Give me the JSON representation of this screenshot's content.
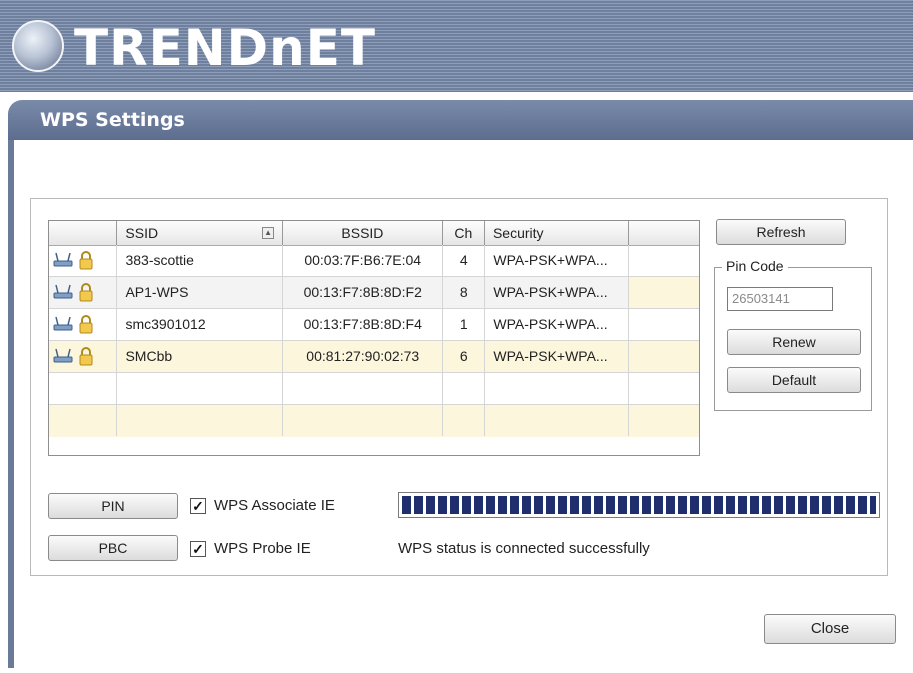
{
  "brand": {
    "name": "TRENDnET"
  },
  "window": {
    "title": "WPS Settings"
  },
  "table": {
    "headers": [
      "",
      "SSID",
      "BSSID",
      "Ch",
      "Security",
      ""
    ],
    "rows": [
      {
        "ssid": "383-scottie",
        "bssid": "00:03:7F:B6:7E:04",
        "ch": "4",
        "security": "WPA-PSK+WPA..."
      },
      {
        "ssid": "AP1-WPS",
        "bssid": "00:13:F7:8B:8D:F2",
        "ch": "8",
        "security": "WPA-PSK+WPA..."
      },
      {
        "ssid": "smc3901012",
        "bssid": "00:13:F7:8B:8D:F4",
        "ch": "1",
        "security": "WPA-PSK+WPA..."
      },
      {
        "ssid": "SMCbb",
        "bssid": "00:81:27:90:02:73",
        "ch": "6",
        "security": "WPA-PSK+WPA..."
      }
    ]
  },
  "buttons": {
    "refresh": "Refresh",
    "renew": "Renew",
    "default": "Default",
    "pin": "PIN",
    "pbc": "PBC",
    "close": "Close"
  },
  "pin_code": {
    "label": "Pin Code",
    "value": "26503141"
  },
  "options": {
    "associate_ie": {
      "label": "WPS Associate IE",
      "checked": true
    },
    "probe_ie": {
      "label": "WPS Probe IE",
      "checked": true
    }
  },
  "progress": {
    "value": 1.0
  },
  "status": {
    "text": "WPS status is connected successfully"
  },
  "colors": {
    "header_bg": "#6f7f9e",
    "title_bg": "#5c6d8f",
    "progress_block": "#1f2f6e"
  }
}
